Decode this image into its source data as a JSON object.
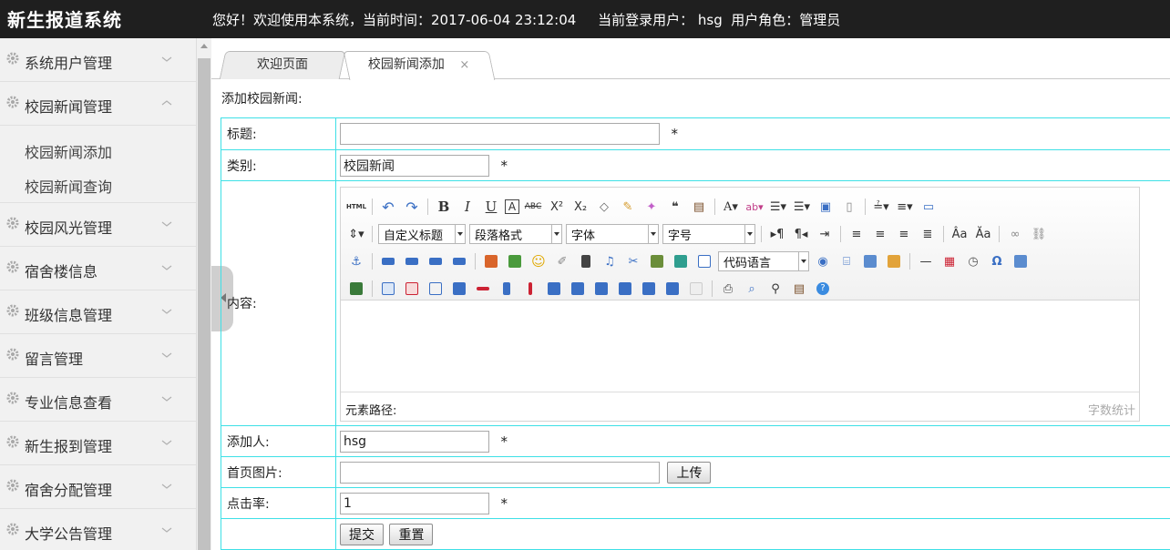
{
  "header": {
    "app_title": "新生报道系统",
    "welcome_text": "您好！欢迎使用本系统，当前时间：2017-06-04 23:12:04     当前登录用户： hsg  用户角色：管理员"
  },
  "sidebar": {
    "items": [
      {
        "label": "系统用户管理",
        "expanded": false
      },
      {
        "label": "校园新闻管理",
        "expanded": true,
        "children": [
          "校园新闻添加",
          "校园新闻查询"
        ]
      },
      {
        "label": "校园风光管理",
        "expanded": false
      },
      {
        "label": "宿舍楼信息",
        "expanded": false
      },
      {
        "label": "班级信息管理",
        "expanded": false
      },
      {
        "label": "留言管理",
        "expanded": false
      },
      {
        "label": "专业信息查看",
        "expanded": false
      },
      {
        "label": "新生报到管理",
        "expanded": false
      },
      {
        "label": "宿舍分配管理",
        "expanded": false
      },
      {
        "label": "大学公告管理",
        "expanded": false
      }
    ]
  },
  "tabs": [
    {
      "label": "欢迎页面",
      "active": false
    },
    {
      "label": "校园新闻添加",
      "active": true,
      "close": "×"
    }
  ],
  "form": {
    "section_title": "添加校园新闻:",
    "title": {
      "label": "标题:",
      "value": "",
      "required": "*"
    },
    "category": {
      "label": "类别:",
      "value": "校园新闻",
      "required": "*"
    },
    "content": {
      "label": "内容:"
    },
    "author": {
      "label": "添加人:",
      "value": "hsg",
      "required": "*"
    },
    "image": {
      "label": "首页图片:",
      "value": "",
      "upload_button": "上传"
    },
    "clicks": {
      "label": "点击率:",
      "value": "1",
      "required": "*"
    },
    "submit_button": "提交",
    "reset_button": "重置"
  },
  "editor": {
    "custom_title": "自定义标题",
    "paragraph_format": "段落格式",
    "font_family": "字体",
    "font_size": "字号",
    "code_language": "代码语言",
    "element_path": "元素路径:",
    "word_count": "字数统计",
    "html_button": "HTML"
  },
  "colors": {
    "topbar": "#1f1f1f",
    "sidebar": "#f1f1f1",
    "table_border": "#3ee0e6"
  }
}
